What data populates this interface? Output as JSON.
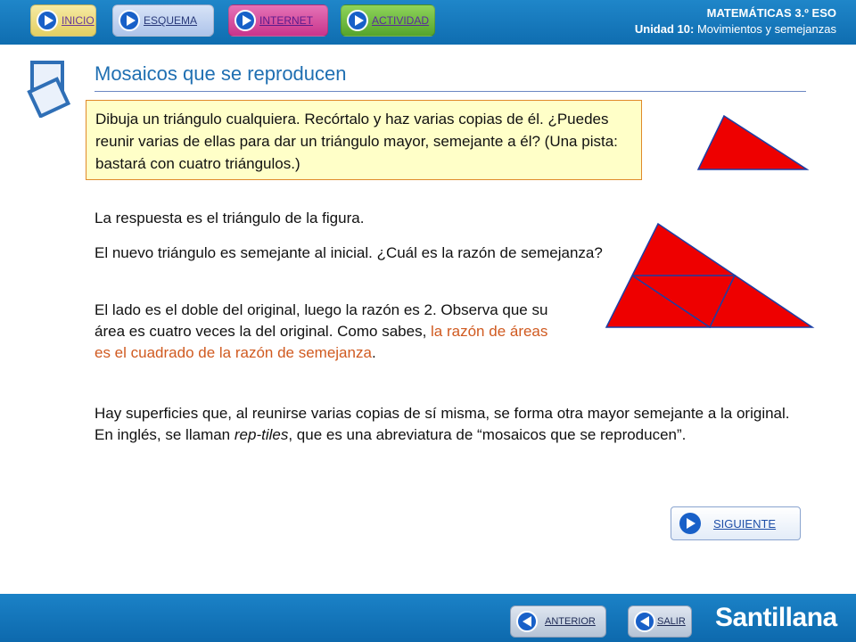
{
  "nav": {
    "inicio": "INICIO",
    "esquema": "ESQUEMA",
    "internet": "INTERNET",
    "actividad": "ACTIVIDAD"
  },
  "header": {
    "subject": "MATEMÁTICAS 3.º ESO",
    "unit_label": "Unidad 10:",
    "unit_title": " Movimientos y semejanzas"
  },
  "page": {
    "title": "Mosaicos que se reproducen",
    "question": "Dibuja un triángulo cualquiera. Recórtalo y haz varias copias de él. ¿Puedes reunir varias de ellas para dar un triángulo mayor, semejante a él? (Una pista: bastará con cuatro triángulos.)",
    "answer": "La respuesta es el triángulo de la figura.",
    "similar": "El nuevo triángulo es semejante al inicial. ¿Cuál es la razón de semejanza?",
    "explain_1": "El lado es el doble del original, luego la razón es 2. Observa que su área es cuatro veces la del original. Como sabes, ",
    "explain_highlight": "la razón de áreas es el cuadrado de la razón de semejanza",
    "explain_2": ".",
    "reptiles_1": "Hay superficies que, al reunirse varias copias de sí misma, se forma otra mayor semejante a la original. En inglés, se llaman ",
    "reptiles_term": "rep-tiles",
    "reptiles_2": ", que es una abreviatura de “mosaicos que se reproducen”."
  },
  "buttons": {
    "siguiente": "SIGUIENTE",
    "anterior": "ANTERIOR",
    "salir": "SALIR"
  },
  "brand": "Santillana",
  "colors": {
    "header_blue": "#1f86c9",
    "title_blue": "#1f6fb2",
    "question_bg": "#ffffc8",
    "question_border": "#e08a2a",
    "highlight": "#d05a20",
    "triangle_fill": "#ee0000",
    "triangle_stroke": "#1b3fa6"
  },
  "icons": {
    "nav": "play-circle-icon",
    "back": "back-circle-icon",
    "title": "tiles-icon"
  }
}
